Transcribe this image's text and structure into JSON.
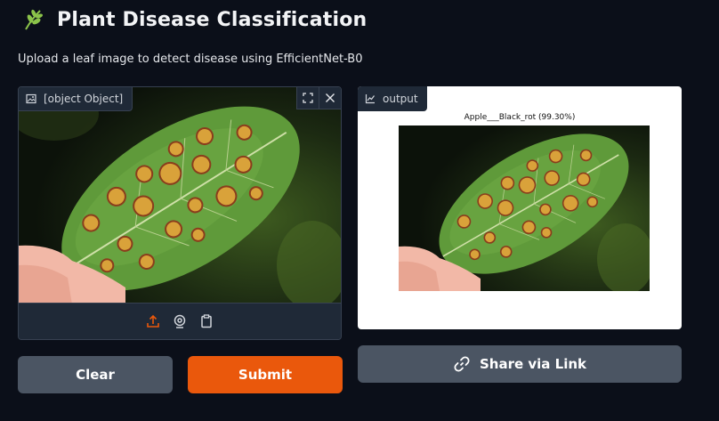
{
  "header": {
    "title": "Plant Disease Classification",
    "icon": "herb-icon",
    "icon_color": "#8bc34a"
  },
  "subtitle": "Upload a leaf image to detect disease using EfficientNet-B0",
  "input_panel": {
    "label": "[object Object]",
    "label_icon": "image-icon",
    "actions": [
      "fullscreen-icon",
      "close-icon"
    ],
    "sources": [
      "upload-icon",
      "webcam-icon",
      "clipboard-icon"
    ],
    "accent": "#ea580c"
  },
  "output_panel": {
    "label": "output",
    "label_icon": "chart-icon",
    "prediction": "Apple___Black_rot (99.30%)"
  },
  "buttons": {
    "clear": "Clear",
    "submit": "Submit",
    "share": "Share via Link"
  },
  "colors": {
    "background": "#0b0f19",
    "panel": "#1f2937",
    "secondary_button": "#4b5563",
    "primary_button": "#ea580c"
  }
}
